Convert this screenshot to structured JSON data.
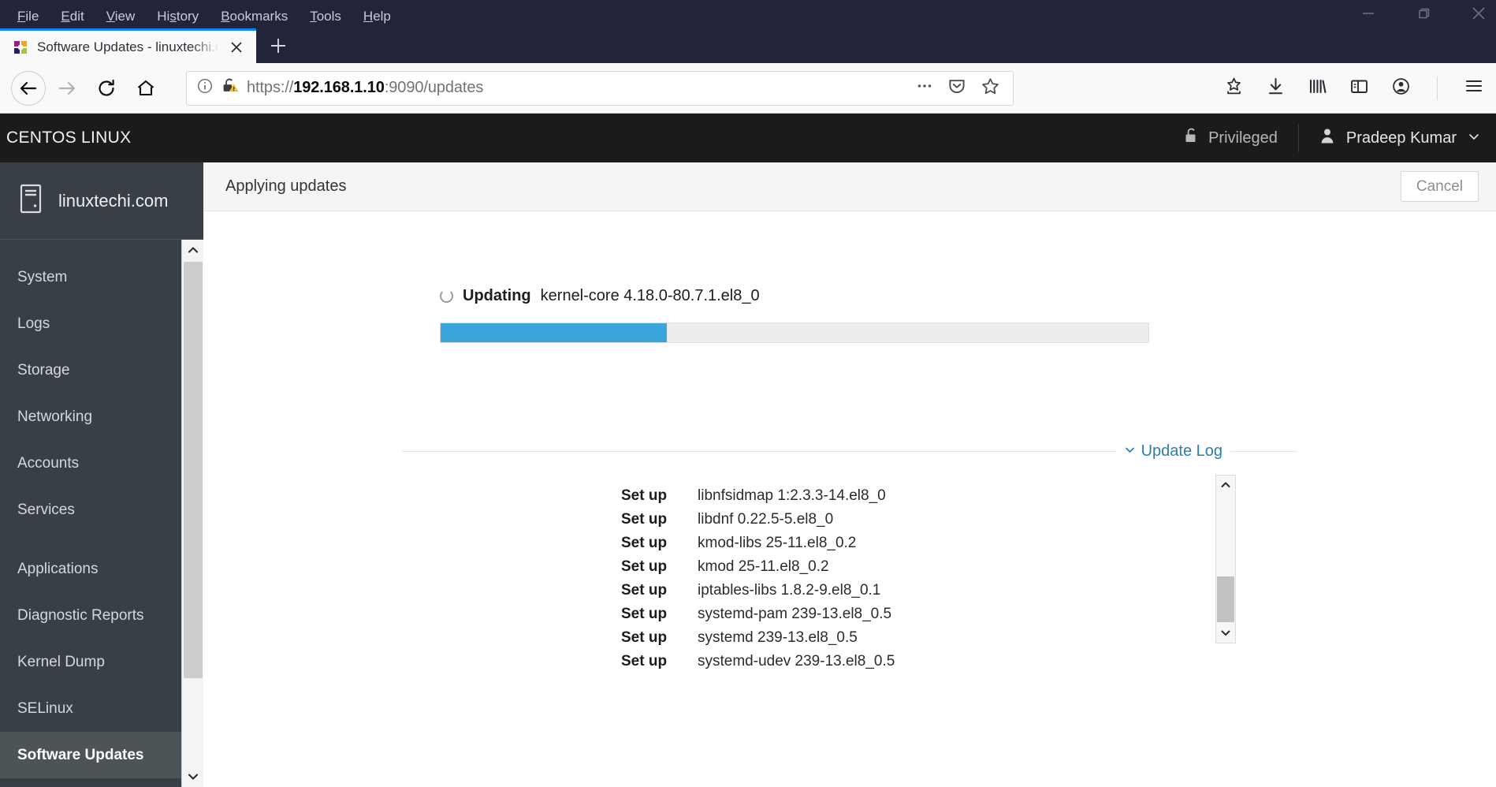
{
  "browser": {
    "menubar": [
      {
        "label": "File",
        "accel": "F"
      },
      {
        "label": "Edit",
        "accel": "E"
      },
      {
        "label": "View",
        "accel": "V"
      },
      {
        "label": "History",
        "accel": "s"
      },
      {
        "label": "Bookmarks",
        "accel": "B"
      },
      {
        "label": "Tools",
        "accel": "T"
      },
      {
        "label": "Help",
        "accel": "H"
      }
    ],
    "window_controls": [
      "minimize",
      "restore",
      "close"
    ],
    "tab": {
      "title": "Software Updates - linuxtechi.c",
      "favicon": "centos-favicon",
      "close": "close-icon"
    },
    "new_tab_label": "+",
    "nav": {
      "back": "back-icon",
      "forward": "forward-icon",
      "reload": "reload-icon",
      "home": "home-icon"
    },
    "url": {
      "scheme": "https://",
      "host": "192.168.1.10",
      "rest": ":9090/updates",
      "full": "https://192.168.1.10:9090/updates",
      "identity_icon": "info-circle-icon",
      "security_icon": "lock-warning-icon"
    },
    "url_actions": [
      "page-actions-icon",
      "pocket-icon",
      "bookmark-star-icon"
    ],
    "toolbar_right": [
      "save-to-pocket-icon",
      "downloads-icon",
      "library-icon",
      "sidebar-icon",
      "account-icon",
      "app-menu-icon"
    ]
  },
  "cockpit": {
    "brand": "CENTOS LINUX",
    "privileged_label": "Privileged",
    "privileged_icon": "unlock-icon",
    "user_name": "Pradeep Kumar",
    "user_icon": "user-icon",
    "user_chevron": "chevron-down-icon",
    "host": {
      "name": "linuxtechi.com",
      "icon": "server-icon"
    },
    "nav_items": [
      {
        "label": "System",
        "active": false,
        "gap_after": false
      },
      {
        "label": "Logs",
        "active": false,
        "gap_after": false
      },
      {
        "label": "Storage",
        "active": false,
        "gap_after": false
      },
      {
        "label": "Networking",
        "active": false,
        "gap_after": false
      },
      {
        "label": "Accounts",
        "active": false,
        "gap_after": false
      },
      {
        "label": "Services",
        "active": false,
        "gap_after": true
      },
      {
        "label": "Applications",
        "active": false,
        "gap_after": false
      },
      {
        "label": "Diagnostic Reports",
        "active": false,
        "gap_after": false
      },
      {
        "label": "Kernel Dump",
        "active": false,
        "gap_after": false
      },
      {
        "label": "SELinux",
        "active": false,
        "gap_after": false
      },
      {
        "label": "Software Updates",
        "active": true,
        "gap_after": false
      }
    ],
    "page": {
      "title": "Applying updates",
      "cancel_label": "Cancel"
    },
    "progress": {
      "state_label": "Updating",
      "package": "kernel-core 4.18.0-80.7.1.el8_0",
      "percent": 32,
      "fill_color": "#39a5dc",
      "track_color": "#ededed",
      "spinner_icon": "spinner-icon"
    },
    "update_log": {
      "toggle_label": "Update Log",
      "toggle_icon": "chevron-down-icon",
      "entries": [
        {
          "action": "Set up",
          "package": "libnfsidmap 1:2.3.3-14.el8_0"
        },
        {
          "action": "Set up",
          "package": "libdnf 0.22.5-5.el8_0"
        },
        {
          "action": "Set up",
          "package": "kmod-libs 25-11.el8_0.2"
        },
        {
          "action": "Set up",
          "package": "kmod 25-11.el8_0.2"
        },
        {
          "action": "Set up",
          "package": "iptables-libs 1.8.2-9.el8_0.1"
        },
        {
          "action": "Set up",
          "package": "systemd-pam 239-13.el8_0.5"
        },
        {
          "action": "Set up",
          "package": "systemd 239-13.el8_0.5"
        },
        {
          "action": "Set up",
          "package": "systemd-udev 239-13.el8_0.5"
        }
      ]
    },
    "colors": {
      "header_bg": "#1b1b1b",
      "sidebar_bg": "#383f45",
      "active_item_bg": "#4c5458",
      "link": "#2d7dad"
    }
  }
}
